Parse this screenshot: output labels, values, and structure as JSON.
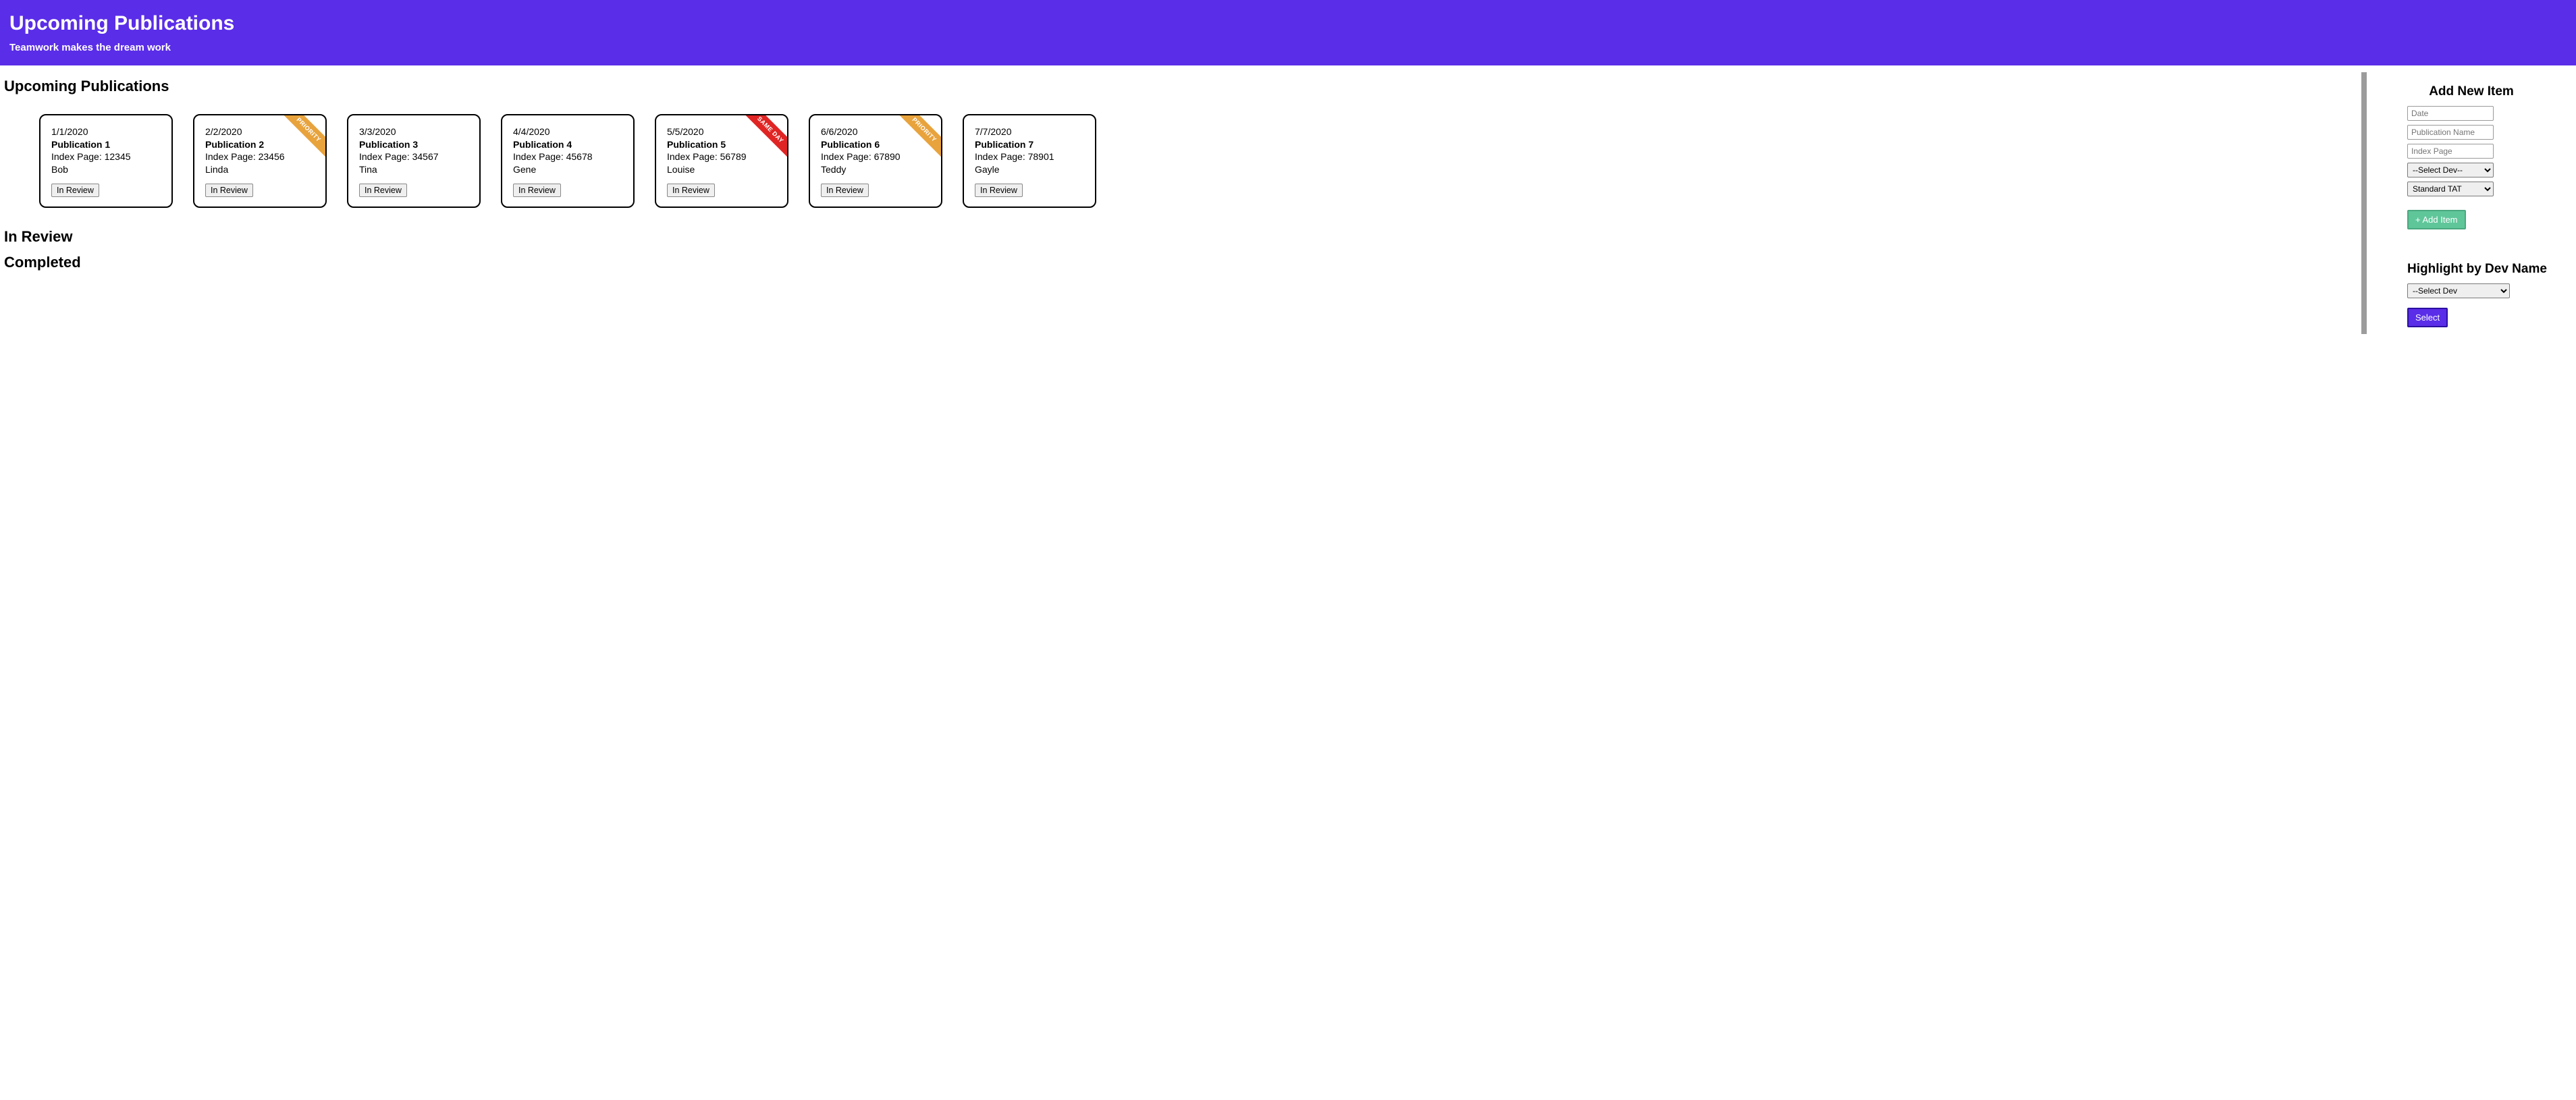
{
  "header": {
    "title": "Upcoming Publications",
    "subtitle": "Teamwork makes the dream work"
  },
  "sections": {
    "upcoming": "Upcoming Publications",
    "inreview": "In Review",
    "completed": "Completed"
  },
  "index_label_prefix": "Index Page: ",
  "review_button_label": "In Review",
  "cards": [
    {
      "date": "1/1/2020",
      "name": "Publication 1",
      "index": "12345",
      "author": "Bob",
      "flag": null
    },
    {
      "date": "2/2/2020",
      "name": "Publication 2",
      "index": "23456",
      "author": "Linda",
      "flag": "priority"
    },
    {
      "date": "3/3/2020",
      "name": "Publication 3",
      "index": "34567",
      "author": "Tina",
      "flag": null
    },
    {
      "date": "4/4/2020",
      "name": "Publication 4",
      "index": "45678",
      "author": "Gene",
      "flag": null
    },
    {
      "date": "5/5/2020",
      "name": "Publication 5",
      "index": "56789",
      "author": "Louise",
      "flag": "sameday"
    },
    {
      "date": "6/6/2020",
      "name": "Publication 6",
      "index": "67890",
      "author": "Teddy",
      "flag": "priority"
    },
    {
      "date": "7/7/2020",
      "name": "Publication 7",
      "index": "78901",
      "author": "Gayle",
      "flag": null
    }
  ],
  "flag_labels": {
    "priority": "PRIORITY",
    "sameday": "SAME DAY"
  },
  "side": {
    "add_title": "Add New Item",
    "date_ph": "Date",
    "name_ph": "Publication Name",
    "index_ph": "Index Page",
    "dev_default": "--Select Dev--",
    "tat_default": "Standard TAT",
    "add_btn": "+ Add Item",
    "highlight_title": "Highlight by Dev Name",
    "highlight_default": "--Select Dev",
    "select_btn": "Select"
  }
}
